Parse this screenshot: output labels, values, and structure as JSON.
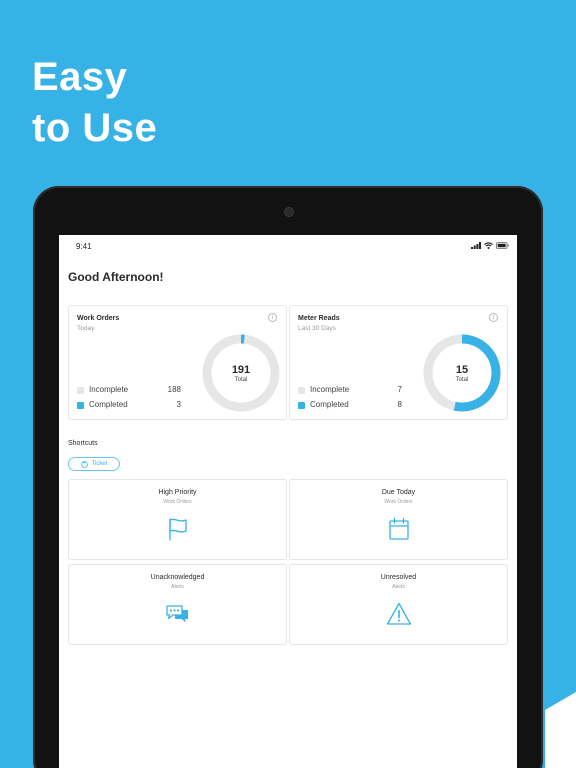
{
  "headline": {
    "line1": "Easy",
    "line2": "to Use"
  },
  "status_bar": {
    "time": "9:41"
  },
  "greeting": "Good Afternoon!",
  "colors": {
    "accent": "#37b2e6",
    "incomplete": "#e6e6e6",
    "completed": "#37b2e6"
  },
  "cards": [
    {
      "title": "Work Orders",
      "subtitle": "Today",
      "total": "191",
      "total_label": "Total",
      "incomplete_label": "Incomplete",
      "incomplete_value": "188",
      "completed_label": "Completed",
      "completed_value": "3",
      "completed_fraction": 0.0157
    },
    {
      "title": "Meter Reads",
      "subtitle": "Last 30 Days",
      "total": "15",
      "total_label": "Total",
      "incomplete_label": "Incomplete",
      "incomplete_value": "7",
      "completed_label": "Completed",
      "completed_value": "8",
      "completed_fraction": 0.5333
    }
  ],
  "shortcuts": {
    "label": "Shortcuts",
    "ticket_button": "Ticket",
    "tiles": [
      {
        "title": "High Priority",
        "subtitle": "Work Orders",
        "icon": "flag-icon"
      },
      {
        "title": "Due Today",
        "subtitle": "Work Orders",
        "icon": "calendar-icon"
      },
      {
        "title": "Unacknowledged",
        "subtitle": "Alerts",
        "icon": "chat-bubbles-icon"
      },
      {
        "title": "Unresolved",
        "subtitle": "Alerts",
        "icon": "warning-icon"
      }
    ]
  }
}
